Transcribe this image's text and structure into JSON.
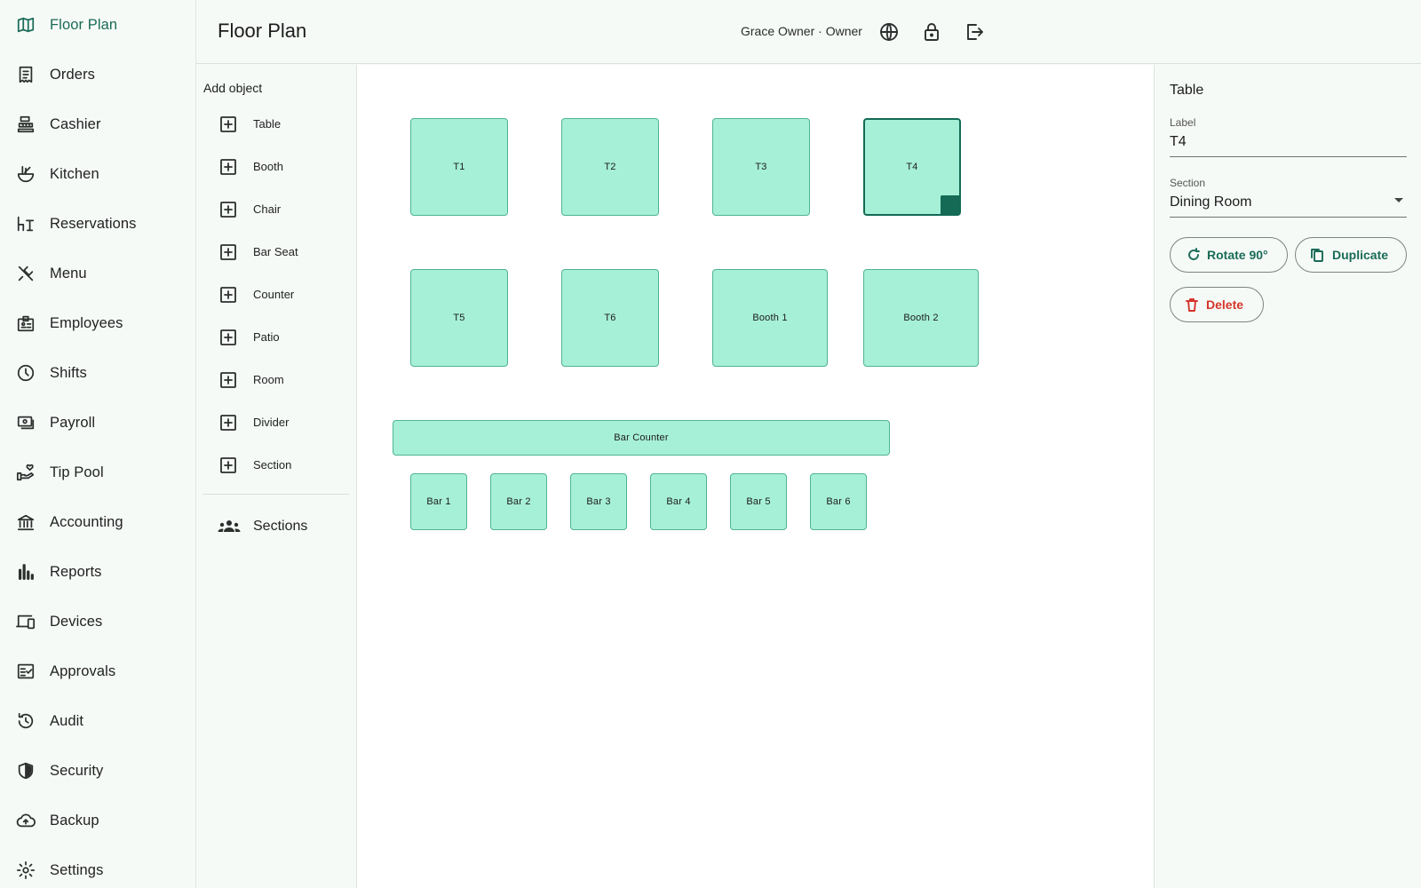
{
  "nav": {
    "items": [
      {
        "key": "floor-plan",
        "label": "Floor Plan",
        "icon": "map-icon",
        "active": true
      },
      {
        "key": "orders",
        "label": "Orders",
        "icon": "receipt-icon"
      },
      {
        "key": "cashier",
        "label": "Cashier",
        "icon": "cash-register-icon"
      },
      {
        "key": "kitchen",
        "label": "Kitchen",
        "icon": "ramen-bowl-icon"
      },
      {
        "key": "reservations",
        "label": "Reservations",
        "icon": "table-chair-icon"
      },
      {
        "key": "menu",
        "label": "Menu",
        "icon": "utensils-icon"
      },
      {
        "key": "employees",
        "label": "Employees",
        "icon": "badge-icon"
      },
      {
        "key": "shifts",
        "label": "Shifts",
        "icon": "clock-icon"
      },
      {
        "key": "payroll",
        "label": "Payroll",
        "icon": "payments-icon"
      },
      {
        "key": "tip-pool",
        "label": "Tip Pool",
        "icon": "hand-heart-icon"
      },
      {
        "key": "accounting",
        "label": "Accounting",
        "icon": "bank-icon"
      },
      {
        "key": "reports",
        "label": "Reports",
        "icon": "bar-chart-icon"
      },
      {
        "key": "devices",
        "label": "Devices",
        "icon": "devices-icon"
      },
      {
        "key": "approvals",
        "label": "Approvals",
        "icon": "checklist-icon"
      },
      {
        "key": "audit",
        "label": "Audit",
        "icon": "history-icon"
      },
      {
        "key": "security",
        "label": "Security",
        "icon": "shield-icon"
      },
      {
        "key": "backup",
        "label": "Backup",
        "icon": "cloud-upload-icon"
      },
      {
        "key": "settings",
        "label": "Settings",
        "icon": "gear-icon"
      }
    ]
  },
  "header": {
    "title": "Floor Plan",
    "user": "Grace Owner · Owner",
    "icons": [
      "globe-icon",
      "lock-icon",
      "logout-icon"
    ]
  },
  "add_panel": {
    "title": "Add object",
    "items": [
      "Table",
      "Booth",
      "Chair",
      "Bar Seat",
      "Counter",
      "Patio",
      "Room",
      "Divider",
      "Section"
    ],
    "sections_label": "Sections"
  },
  "floor": {
    "objects": [
      {
        "label": "T1"
      },
      {
        "label": "T2"
      },
      {
        "label": "T3"
      },
      {
        "label": "T4",
        "selected": true
      },
      {
        "label": "T5"
      },
      {
        "label": "T6"
      },
      {
        "label": "Booth 1"
      },
      {
        "label": "Booth 2"
      },
      {
        "label": "Bar Counter"
      },
      {
        "label": "Bar 1"
      },
      {
        "label": "Bar 2"
      },
      {
        "label": "Bar 3"
      },
      {
        "label": "Bar 4"
      },
      {
        "label": "Bar 5"
      },
      {
        "label": "Bar 6"
      }
    ]
  },
  "properties": {
    "title": "Table",
    "label_field": {
      "label": "Label",
      "value": "T4"
    },
    "section_field": {
      "label": "Section",
      "value": "Dining Room"
    },
    "rotate_label": "Rotate 90°",
    "duplicate_label": "Duplicate",
    "delete_label": "Delete"
  },
  "colors": {
    "accent": "#1a6b57",
    "object_fill": "#a6f0d7",
    "danger": "#d5352a"
  }
}
